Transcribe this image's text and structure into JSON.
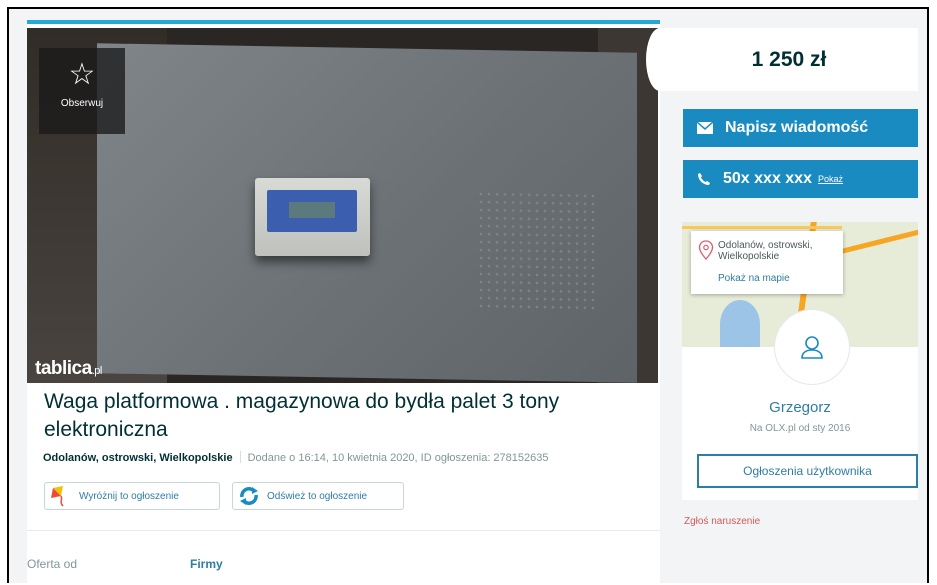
{
  "watch": {
    "label": "Obserwuj",
    "icon": "star-outline-icon"
  },
  "brand": {
    "name": "tablica",
    "tld": ".pl"
  },
  "listing": {
    "title": "Waga platformowa . magazynowa do bydła palet 3 tony elektroniczna",
    "location": "Odolanów, ostrowski, Wielkopolskie",
    "details": "Dodane o 16:14, 10 kwietnia 2020, ID ogłoszenia: 278152635"
  },
  "actions": {
    "highlight": "Wyróżnij to ogłoszenie",
    "refresh": "Odśwież to ogłoszenie"
  },
  "params": {
    "offer_label": "Oferta od",
    "offer_value": "Firmy"
  },
  "sidebar": {
    "price": "1 250 zł",
    "message_button": "Napisz wiadomość",
    "phone_button": "50x xxx xxx",
    "phone_show": "Pokaż",
    "map_address": "Odolanów, ostrowski, Wielkopolskie",
    "map_link": "Pokaż na mapie",
    "seller_name": "Grzegorz",
    "seller_since": "Na OLX.pl od sty 2016",
    "user_ads_button": "Ogłoszenia użytkownika",
    "report": "Zgłoś naruszenie"
  },
  "colors": {
    "accent": "#1a8bc1",
    "link": "#2e7ea3",
    "text": "#002f34",
    "report": "#d45a5a"
  }
}
